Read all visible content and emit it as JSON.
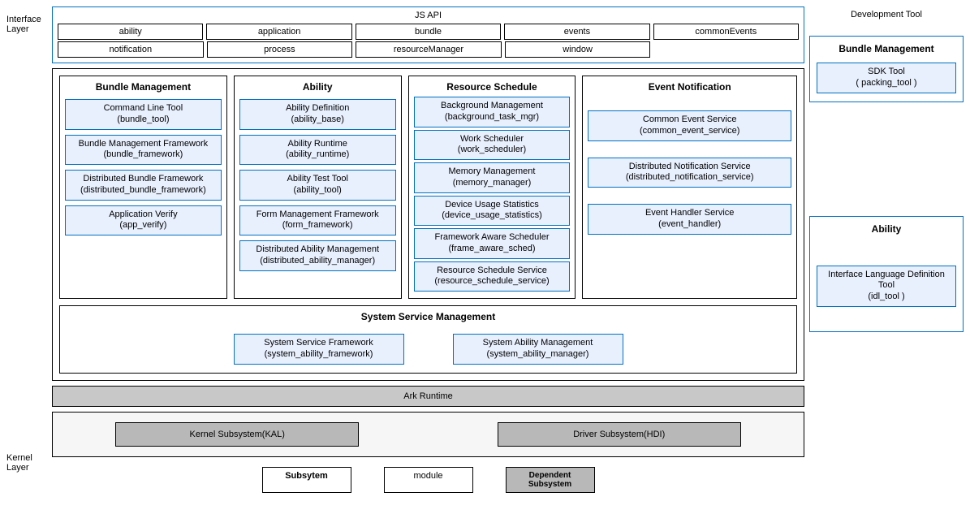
{
  "labels": {
    "interface_layer": "Interface Layer",
    "kernel_layer": "Kernel Layer"
  },
  "jsapi": {
    "title": "JS API",
    "row1": [
      "ability",
      "application",
      "bundle",
      "events",
      "commonEvents"
    ],
    "row2": [
      "notification",
      "process",
      "resourceManager",
      "window"
    ]
  },
  "subsystems": {
    "bundle_mgmt": {
      "title": "Bundle Management",
      "modules": [
        {
          "name": "Command Line Tool",
          "pkg": "(bundle_tool)"
        },
        {
          "name": "Bundle Management Framework",
          "pkg": "(bundle_framework)"
        },
        {
          "name": "Distributed Bundle Framework",
          "pkg": "(distributed_bundle_framework)"
        },
        {
          "name": "Application Verify",
          "pkg": "(app_verify)"
        }
      ]
    },
    "ability": {
      "title": "Ability",
      "modules": [
        {
          "name": "Ability Definition",
          "pkg": "(ability_base)"
        },
        {
          "name": "Ability Runtime",
          "pkg": "(ability_runtime)"
        },
        {
          "name": "Ability Test Tool",
          "pkg": "(ability_tool)"
        },
        {
          "name": "Form Management Framework",
          "pkg": "(form_framework)"
        },
        {
          "name": "Distributed Ability Management",
          "pkg": "(distributed_ability_manager)"
        }
      ]
    },
    "resource": {
      "title": "Resource Schedule",
      "modules": [
        {
          "name": "Background Management",
          "pkg": "(background_task_mgr)"
        },
        {
          "name": "Work Scheduler",
          "pkg": "(work_scheduler)"
        },
        {
          "name": "Memory Management",
          "pkg": "(memory_manager)"
        },
        {
          "name": "Device Usage Statistics",
          "pkg": "(device_usage_statistics)"
        },
        {
          "name": "Framework Aware Scheduler",
          "pkg": "(frame_aware_sched)"
        },
        {
          "name": "Resource Schedule Service",
          "pkg": "(resource_schedule_service)"
        }
      ]
    },
    "event": {
      "title": "Event Notification",
      "modules": [
        {
          "name": "Common Event Service",
          "pkg": "(common_event_service)"
        },
        {
          "name": "Distributed Notification Service",
          "pkg": "(distributed_notification_service)"
        },
        {
          "name": "Event Handler Service",
          "pkg": "(event_handler)"
        }
      ]
    }
  },
  "ssm": {
    "title": "System Service Management",
    "modules": [
      {
        "name": "System Service Framework",
        "pkg": "(system_ability_framework)"
      },
      {
        "name": "System Ability Management",
        "pkg": "(system_ability_manager)"
      }
    ]
  },
  "ark": "Ark Runtime",
  "kernel": {
    "kal": "Kernel Subsystem(KAL)",
    "hdi": "Driver Subsystem(HDI)"
  },
  "legend": {
    "subsystem": "Subsytem",
    "module": "module",
    "dependent": "Dependent Subsystem"
  },
  "dev": {
    "title": "Development Tool",
    "bundle_mgmt": {
      "title": "Bundle Management",
      "module": {
        "name": "SDK Tool",
        "pkg": "( packing_tool )"
      }
    },
    "ability": {
      "title": "Ability",
      "module": {
        "name": "Interface Language Definition Tool",
        "pkg": "(idl_tool )"
      }
    }
  }
}
